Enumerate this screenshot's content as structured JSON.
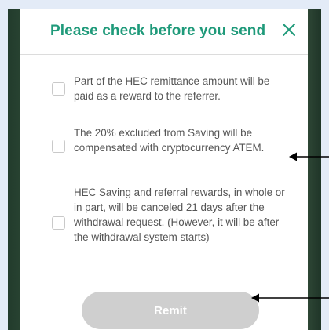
{
  "dialog": {
    "title": "Please check before you send",
    "close_icon": "close-icon"
  },
  "checklist": [
    {
      "text": "Part of the HEC remittance amount will be paid as a reward to the referrer.",
      "checked": false
    },
    {
      "text": "The 20% excluded from Saving will be compensated with cryptocurrency ATEM.",
      "checked": false
    },
    {
      "text": "HEC Saving and referral rewards, in whole or in part, will be canceled 21 days after the withdrawal request. (However, it will be after the withdrawal system starts)",
      "checked": false
    }
  ],
  "remit_button": {
    "label": "Remit",
    "enabled": false
  },
  "annotations": {
    "arrow_icon": "left-arrow-icon",
    "color": "#000000"
  },
  "colors": {
    "title": "#1f9a7a",
    "button_disabled": "#cfcfcf",
    "text": "#555555"
  }
}
